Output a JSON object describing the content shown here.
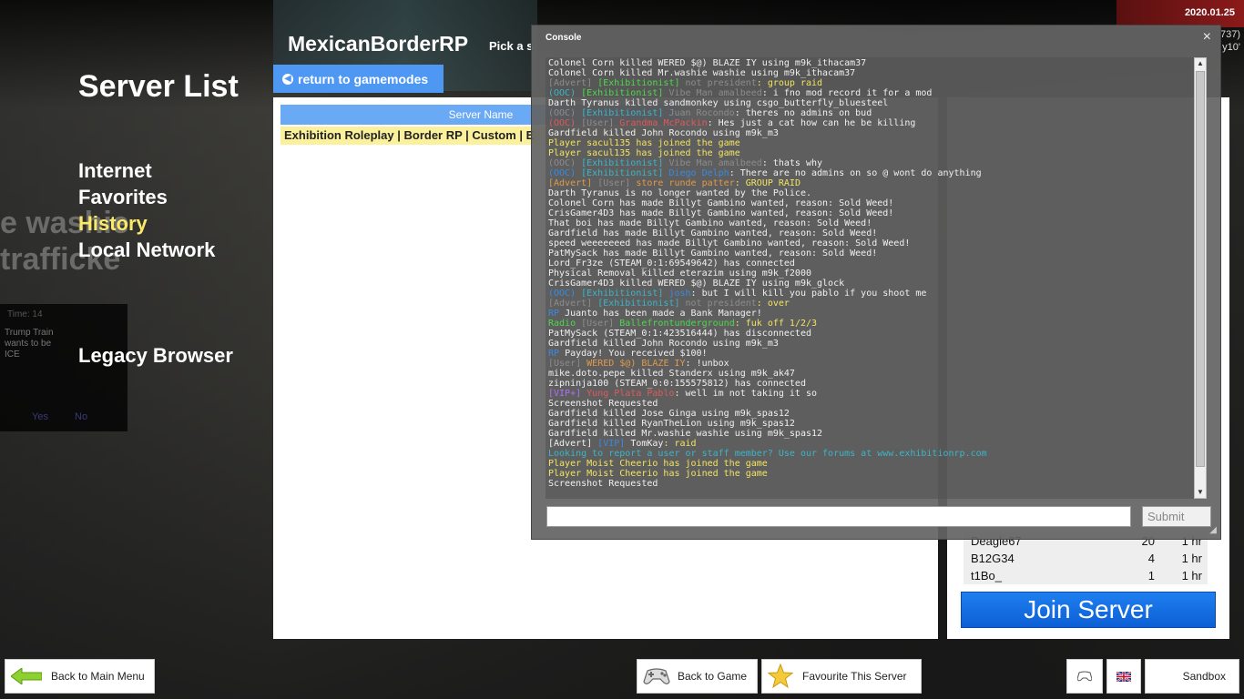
{
  "hud": {
    "date": "2020.01.25",
    "side_lines": [
      "737)",
      "y10'"
    ]
  },
  "background": {
    "text_lines": [
      "e washie",
      "trafficke"
    ]
  },
  "vote": {
    "time": "Time: 14",
    "text": "Trump Train wants to be ICE",
    "yes": "Yes",
    "no": "No"
  },
  "menu": {
    "title": "Server List",
    "items": [
      "Internet",
      "Favorites",
      "History",
      "Local Network"
    ],
    "active_index": 2,
    "legacy": "Legacy Browser"
  },
  "gamemode": {
    "title": "MexicanBorderRP",
    "pick_label": "Pick a s",
    "return_label": "return to gamemodes"
  },
  "server_list": {
    "column_header": "Server Name",
    "rows": [
      "Exhibition Roleplay | Border RP | Custom | E"
    ]
  },
  "players": [
    {
      "name": "Deagle67",
      "score": "20",
      "time": "1 hr"
    },
    {
      "name": "B12G34",
      "score": "4",
      "time": "1 hr"
    },
    {
      "name": "t1Bo_",
      "score": "1",
      "time": "1 hr"
    }
  ],
  "join_label": "Join Server",
  "console": {
    "title": "Console",
    "close": "×",
    "input_value": "",
    "submit_label": "Submit",
    "lines": [
      [
        {
          "t": "Colonel Corn killed WERED $@) BLAZE IY using m9k_ithacam37",
          "c": "w"
        }
      ],
      [
        {
          "t": "Colonel Corn killed Mr.washie washie using m9k_ithacam37",
          "c": "w"
        }
      ],
      [
        {
          "t": "[Advert] ",
          "c": "gray"
        },
        {
          "t": "[Exhibitionist] ",
          "c": "green"
        },
        {
          "t": "not president",
          "c": "gray"
        },
        {
          "t": ": group raid",
          "c": "y"
        }
      ],
      [
        {
          "t": "(OOC) ",
          "c": "cyan"
        },
        {
          "t": "[Exhibitionist] ",
          "c": "green"
        },
        {
          "t": "Vibe Man amalbeed",
          "c": "gray"
        },
        {
          "t": ": i fno mod record it for a mod",
          "c": "w"
        }
      ],
      [
        {
          "t": "Darth Tyranus killed sandmonkey using csgo_butterfly_bluesteel",
          "c": "w"
        }
      ],
      [
        {
          "t": "(OOC) ",
          "c": "gray"
        },
        {
          "t": "[Exhibitionist] ",
          "c": "cyan"
        },
        {
          "t": "Juan Rocondo",
          "c": "gray"
        },
        {
          "t": ": theres no admins on bud",
          "c": "w"
        }
      ],
      [
        {
          "t": "(OOC) ",
          "c": "red"
        },
        {
          "t": "[User] ",
          "c": "gray"
        },
        {
          "t": "Grandma McPackin",
          "c": "red"
        },
        {
          "t": ": Hes just a cat how can he be killing",
          "c": "w"
        }
      ],
      [
        {
          "t": "Gardfield killed John Rocondo using m9k_m3",
          "c": "w"
        }
      ],
      [
        {
          "t": "Player sacul135 has joined the game",
          "c": "y"
        }
      ],
      [
        {
          "t": "Player sacul135 has joined the game",
          "c": "y"
        }
      ],
      [
        {
          "t": "(OOC) ",
          "c": "gray"
        },
        {
          "t": "[Exhibitionist] ",
          "c": "cyan"
        },
        {
          "t": "Vibe Man amalbeed",
          "c": "gray"
        },
        {
          "t": ": thats why",
          "c": "w"
        }
      ],
      [
        {
          "t": "(OOC) ",
          "c": "blue"
        },
        {
          "t": "[Exhibitionist] ",
          "c": "cyan"
        },
        {
          "t": "Diego Delph",
          "c": "blue"
        },
        {
          "t": ": There are no admins on so @ wont do anything",
          "c": "w"
        }
      ],
      [
        {
          "t": "[Advert] ",
          "c": "orange"
        },
        {
          "t": "[User] ",
          "c": "gray"
        },
        {
          "t": "store runde patter",
          "c": "orange"
        },
        {
          "t": ": GROUP RAID",
          "c": "y"
        }
      ],
      [
        {
          "t": "Darth Tyranus is no longer wanted by the Police.",
          "c": "w"
        }
      ],
      [
        {
          "t": "Colonel Corn has made Billyt Gambino wanted, reason: Sold Weed!",
          "c": "w"
        }
      ],
      [
        {
          "t": "CrisGamer4D3 has made Billyt Gambino wanted, reason: Sold Weed!",
          "c": "w"
        }
      ],
      [
        {
          "t": "That boi has made Billyt Gambino wanted, reason: Sold Weed!",
          "c": "w"
        }
      ],
      [
        {
          "t": "Gardfield has made Billyt Gambino wanted, reason: Sold Weed!",
          "c": "w"
        }
      ],
      [
        {
          "t": "speed weeeeeeed has made Billyt Gambino wanted, reason: Sold Weed!",
          "c": "w"
        }
      ],
      [
        {
          "t": "PatMySack has made Billyt Gambino wanted, reason: Sold Weed!",
          "c": "w"
        }
      ],
      [
        {
          "t": "Lord_Fr3ze (STEAM_0:1:69549642) has connected",
          "c": "w"
        }
      ],
      [
        {
          "t": "Physical Removal killed eterazim using m9k_f2000",
          "c": "w"
        }
      ],
      [
        {
          "t": "CrisGamer4D3 killed WERED $@) BLAZE IY using m9k_glock",
          "c": "w"
        }
      ],
      [
        {
          "t": "(OOC) ",
          "c": "blue"
        },
        {
          "t": "[Exhibitionist] ",
          "c": "cyan"
        },
        {
          "t": "josh",
          "c": "blue"
        },
        {
          "t": ": but I will kill you pablo if you shoot me",
          "c": "w"
        }
      ],
      [
        {
          "t": "[Advert] ",
          "c": "gray"
        },
        {
          "t": "[Exhibitionist] ",
          "c": "cyan"
        },
        {
          "t": "not president",
          "c": "gray"
        },
        {
          "t": ": over",
          "c": "y"
        }
      ],
      [
        {
          "t": "RP ",
          "c": "blue"
        },
        {
          "t": "Juanto has been made a Bank Manager!",
          "c": "w"
        }
      ],
      [
        {
          "t": "Radio ",
          "c": "green"
        },
        {
          "t": "[User] ",
          "c": "gray"
        },
        {
          "t": "Ballefrontunderground",
          "c": "green"
        },
        {
          "t": ": fuk off 1/2/3",
          "c": "y"
        }
      ],
      [
        {
          "t": "PatMySack (STEAM_0:1:423516444) has disconnected",
          "c": "w"
        }
      ],
      [
        {
          "t": "Gardfield killed John Rocondo using m9k_m3",
          "c": "w"
        }
      ],
      [
        {
          "t": "RP ",
          "c": "blue"
        },
        {
          "t": "Payday! You received $100!",
          "c": "w"
        }
      ],
      [
        {
          "t": " [User] ",
          "c": "gray"
        },
        {
          "t": "WERED $@) BLAZE IY",
          "c": "orange"
        },
        {
          "t": ": !unbox",
          "c": "w"
        }
      ],
      [
        {
          "t": "mike.doto.pepe killed Standerx using m9k_ak47",
          "c": "w"
        }
      ],
      [
        {
          "t": "zipninja100 (STEAM_0:0:155575812) has connected",
          "c": "w"
        }
      ],
      [
        {
          "t": "     [VIP+] ",
          "c": "purple"
        },
        {
          "t": "Yung Plata Pablo",
          "c": "red"
        },
        {
          "t": ": well im not taking it so",
          "c": "w"
        }
      ],
      [
        {
          "t": "Screenshot Requested",
          "c": "w"
        }
      ],
      [
        {
          "t": "Gardfield killed Jose Ginga using m9k_spas12",
          "c": "w"
        }
      ],
      [
        {
          "t": "Gardfield killed RyanTheLion using m9k_spas12",
          "c": "w"
        }
      ],
      [
        {
          "t": "Gardfield killed Mr.washie washie using m9k_spas12",
          "c": "w"
        }
      ],
      [
        {
          "t": "[Advert] ",
          "c": "w"
        },
        {
          "t": "[VIP] ",
          "c": "blue"
        },
        {
          "t": "TomKay",
          "c": "w"
        },
        {
          "t": ": raid",
          "c": "y"
        }
      ],
      [
        {
          "t": "Looking to report a user or staff member? Use our forums at www.exhibitionrp.com",
          "c": "cyan"
        }
      ],
      [
        {
          "t": "Player Moist Cheerio has joined the game",
          "c": "y"
        }
      ],
      [
        {
          "t": "Player Moist Cheerio has joined the game",
          "c": "y"
        }
      ],
      [
        {
          "t": "Screenshot Requested",
          "c": "w"
        }
      ]
    ]
  },
  "bottom": {
    "back_main": "Back to Main Menu",
    "back_game": "Back to Game",
    "favourite": "Favourite This Server",
    "sandbox": "Sandbox"
  }
}
